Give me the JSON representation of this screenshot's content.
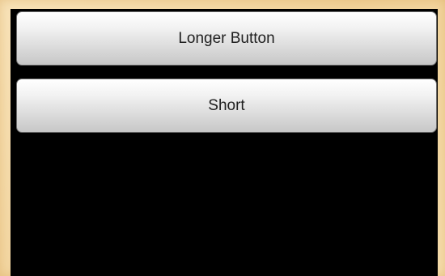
{
  "buttons": {
    "longer_label": "Longer Button",
    "short_label": "Short"
  }
}
